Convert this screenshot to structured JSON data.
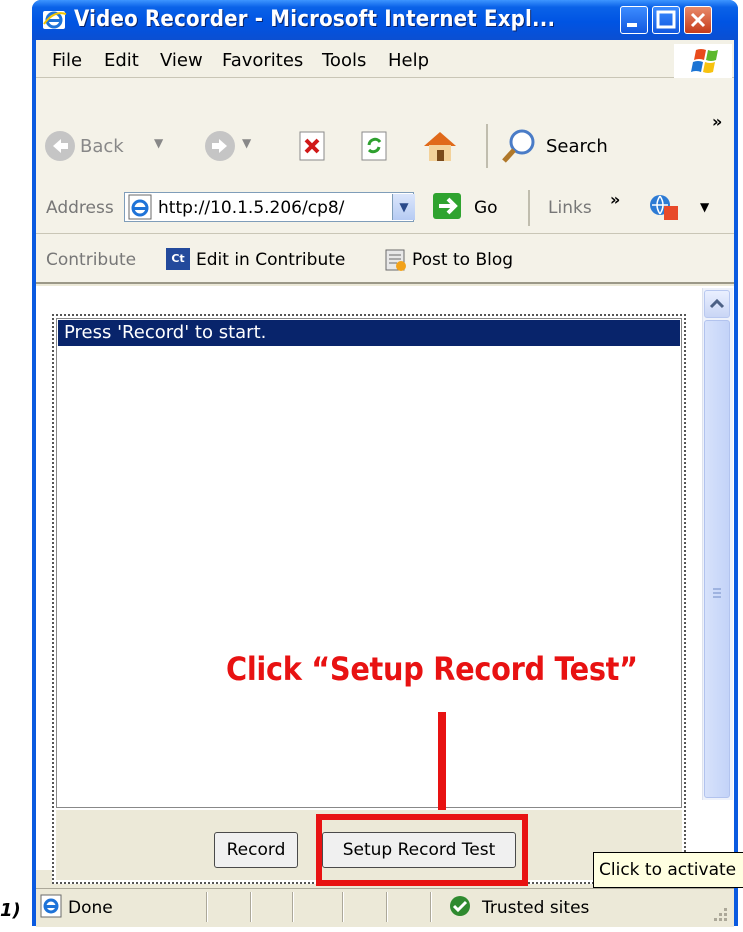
{
  "window": {
    "title": "Video Recorder - Microsoft Internet Expl..."
  },
  "menu": [
    "File",
    "Edit",
    "View",
    "Favorites",
    "Tools",
    "Help"
  ],
  "toolbar": {
    "back": "Back",
    "search": "Search",
    "overflow": "»"
  },
  "address": {
    "label": "Address",
    "url": "http://10.1.5.206/cp8/",
    "go": "Go",
    "links": "Links",
    "links_more": "»"
  },
  "contribute": {
    "label": "Contribute",
    "edit": "Edit in Contribute",
    "edit_badge": "Ct",
    "blog": "Post to Blog"
  },
  "applet": {
    "list_selected": "Press 'Record' to start.",
    "record_button": "Record",
    "setup_button": "Setup Record Test"
  },
  "annotation": {
    "text": "Click “Setup Record Test”",
    "tooltip": "Click to activate",
    "step": "1)"
  },
  "status": {
    "left": "Done",
    "zone": "Trusted sites"
  }
}
